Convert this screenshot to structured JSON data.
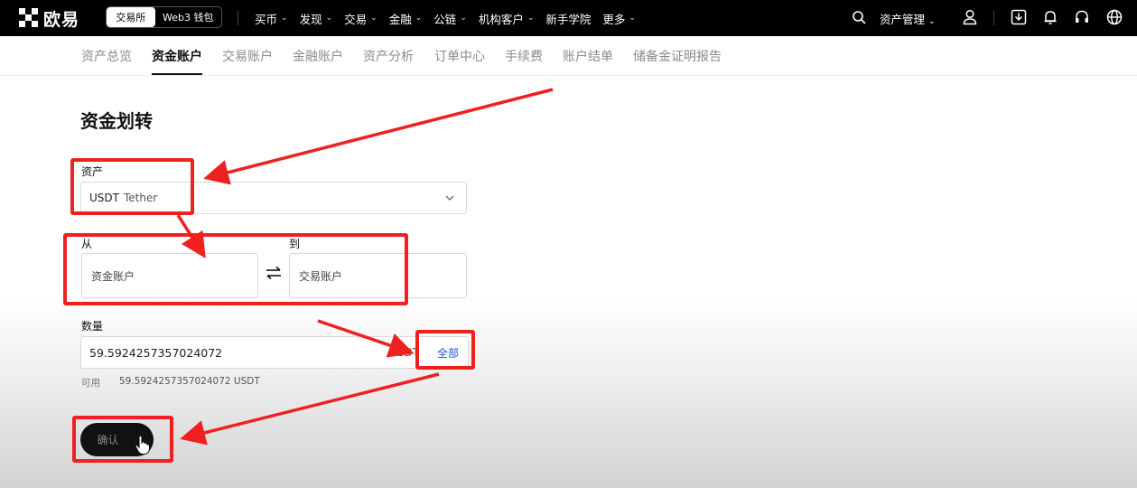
{
  "app": {
    "logo_text": "欧易",
    "mode_tabs": [
      "交易所",
      "Web3 钱包"
    ],
    "nav_items": [
      "买币",
      "发现",
      "交易",
      "金融",
      "公链",
      "机构客户",
      "新手学院",
      "更多"
    ],
    "asset_management": "资产管理"
  },
  "subnav": {
    "tabs": [
      "资产总览",
      "资金账户",
      "交易账户",
      "金融账户",
      "资产分析",
      "订单中心",
      "手续费",
      "账户结单",
      "储备金证明报告"
    ],
    "active": "资金账户"
  },
  "form": {
    "title": "资金划转",
    "asset_label": "资产",
    "asset_symbol": "USDT",
    "asset_name": "Tether",
    "from_label": "从",
    "from_account": "资金账户",
    "to_label": "到",
    "to_account": "交易账户",
    "amount_label": "数量",
    "amount_value": "59.5924257357024072",
    "amount_unit": "USDT",
    "all_button": "全部",
    "available_label": "可用",
    "available_value": "59.5924257357024072 USDT",
    "confirm_button": "确认"
  },
  "colors": {
    "annotation": "#ef2020",
    "link": "#1a56d6",
    "nav_bg": "#000000"
  },
  "icons": [
    "search-icon",
    "user-icon",
    "download-icon",
    "bell-icon",
    "headset-icon",
    "globe-icon",
    "swap-icon",
    "chevron-down-icon",
    "cursor-hand-icon"
  ]
}
